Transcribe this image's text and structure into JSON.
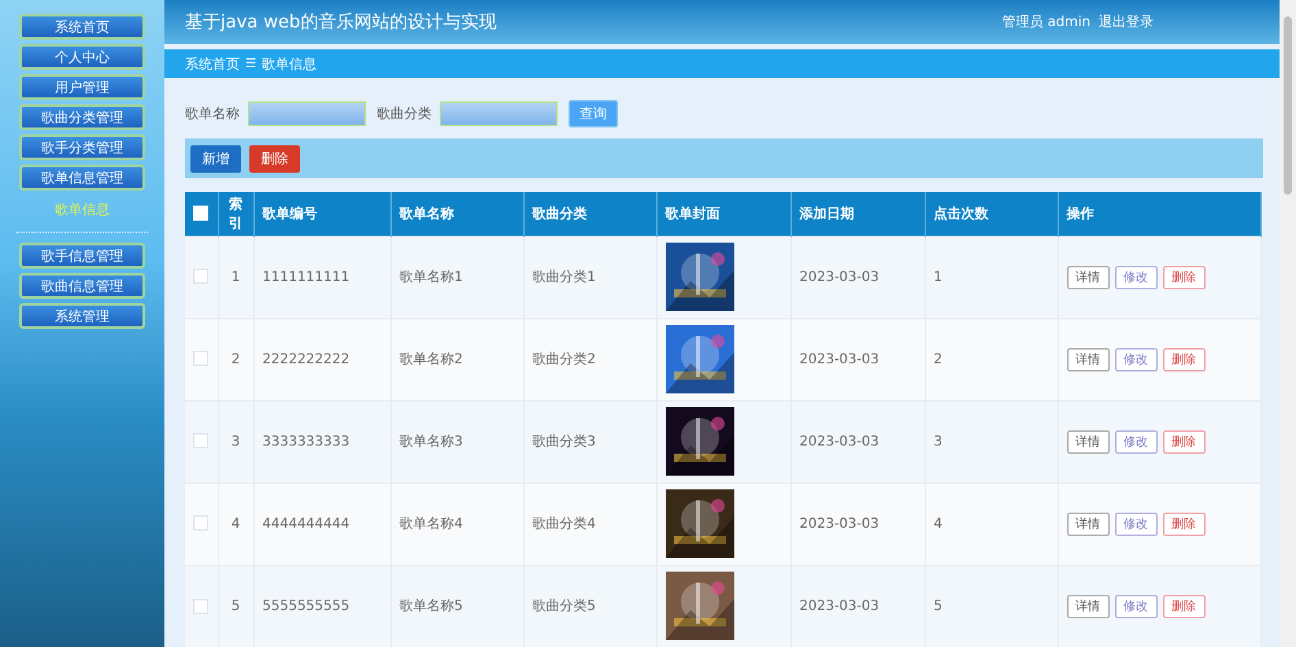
{
  "sidebar": {
    "items": [
      {
        "label": "系统首页",
        "kind": "button",
        "selected": false
      },
      {
        "label": "个人中心",
        "kind": "button",
        "selected": false
      },
      {
        "label": "用户管理",
        "kind": "button",
        "selected": false
      },
      {
        "label": "歌曲分类管理",
        "kind": "button",
        "selected": false
      },
      {
        "label": "歌手分类管理",
        "kind": "button",
        "selected": false
      },
      {
        "label": "歌单信息管理",
        "kind": "button",
        "selected": false
      },
      {
        "label": "歌单信息",
        "kind": "link",
        "selected": true
      },
      {
        "label": "歌手信息管理",
        "kind": "button",
        "selected": false
      },
      {
        "label": "歌曲信息管理",
        "kind": "button",
        "selected": false
      },
      {
        "label": "系统管理",
        "kind": "button",
        "selected": false
      }
    ]
  },
  "header": {
    "title": "基于java web的音乐网站的设计与实现",
    "user": "管理员 admin",
    "logout": "退出登录"
  },
  "breadcrumb": [
    "系统首页",
    "歌单信息"
  ],
  "breadcrumb_separator": "☰",
  "search": {
    "fields": [
      {
        "label": "歌单名称"
      },
      {
        "label": "歌曲分类"
      }
    ],
    "button": "查询"
  },
  "actions": [
    {
      "label": "新增",
      "kind": "primary"
    },
    {
      "label": "删除",
      "kind": "danger"
    }
  ],
  "table": {
    "select_all": {
      "checked": false
    },
    "columns": [
      "索引",
      "歌单编号",
      "歌单名称",
      "歌曲分类",
      "歌单封面",
      "添加日期",
      "点击次数",
      "操作"
    ],
    "rows": [
      {
        "checked": false,
        "index": "1",
        "code": "1111111111",
        "name": "歌单名称1",
        "category": "歌曲分类1",
        "date": "2023-03-03",
        "clicks": "1",
        "buttons": [
          "详情",
          "修改",
          "删除"
        ]
      },
      {
        "checked": false,
        "index": "2",
        "code": "2222222222",
        "name": "歌单名称2",
        "category": "歌曲分类2",
        "date": "2023-03-03",
        "clicks": "2",
        "buttons": [
          "详情",
          "修改",
          "删除"
        ]
      },
      {
        "checked": false,
        "index": "3",
        "code": "3333333333",
        "name": "歌单名称3",
        "category": "歌曲分类3",
        "date": "2023-03-03",
        "clicks": "3",
        "buttons": [
          "详情",
          "修改",
          "删除"
        ]
      },
      {
        "checked": false,
        "index": "4",
        "code": "4444444444",
        "name": "歌单名称4",
        "category": "歌曲分类4",
        "date": "2023-03-03",
        "clicks": "4",
        "buttons": [
          "详情",
          "修改",
          "删除"
        ]
      },
      {
        "checked": false,
        "index": "5",
        "code": "5555555555",
        "name": "歌单名称5",
        "category": "歌曲分类5",
        "date": "2023-03-03",
        "clicks": "5",
        "buttons": [
          "详情",
          "修改",
          "删除"
        ]
      }
    ]
  }
}
